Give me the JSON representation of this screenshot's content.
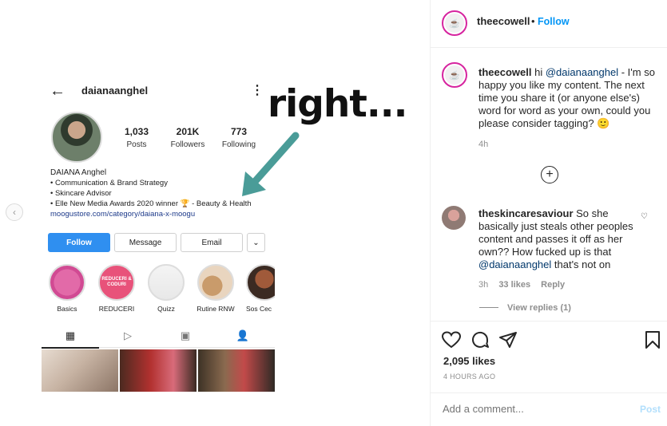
{
  "annotation": {
    "text": "right..."
  },
  "profile": {
    "username": "daianaanghel",
    "stats": [
      {
        "num": "1,033",
        "label": "Posts"
      },
      {
        "num": "201K",
        "label": "Followers"
      },
      {
        "num": "773",
        "label": "Following"
      }
    ],
    "bio": {
      "name": "DAIANA Anghel",
      "lines": [
        "• Communication & Brand Strategy",
        "• Skincare Advisor",
        "• Elle New Media Awards 2020 winner 🏆 - Beauty & Health"
      ],
      "link": "moogustore.com/category/daiana-x-moogu"
    },
    "buttons": {
      "follow": "Follow",
      "message": "Message",
      "email": "Email"
    },
    "highlights": [
      {
        "label": "Basics"
      },
      {
        "label": "REDUCERI",
        "inner": "REDUCERI & CODURI"
      },
      {
        "label": "Quizz"
      },
      {
        "label": "Rutine RNW"
      },
      {
        "label": "Sos Cec"
      }
    ]
  },
  "post": {
    "author": "theecowell",
    "follow_label": "Follow",
    "caption": {
      "user": "theecowell",
      "text_before": "hi ",
      "mention": "@daianaanghel",
      "text_after": " - I'm so happy you like my content. The next time you share it (or anyone else's) word for word as your own, could you please consider tagging? 🙂",
      "time": "4h"
    },
    "comment": {
      "user": "theskincaresaviour",
      "text_before": "So she basically just steals other peoples content and passes it off as her own?? How fucked up is that ",
      "mention": "@daianaanghel",
      "text_after": " that's not on",
      "time": "3h",
      "likes": "33 likes",
      "reply": "Reply",
      "view_replies": "View replies (1)"
    },
    "likes": "2,095 likes",
    "time_ago": "4 HOURS AGO",
    "add_comment_placeholder": "Add a comment...",
    "post_label": "Post"
  },
  "icons": {
    "back": "←",
    "more": "⋮",
    "prev": "‹",
    "plus": "+",
    "heart_small": "♡",
    "chevron": "⌄",
    "grid": "▦",
    "reels": "▷",
    "igtv": "▣",
    "tagged": "👤"
  }
}
